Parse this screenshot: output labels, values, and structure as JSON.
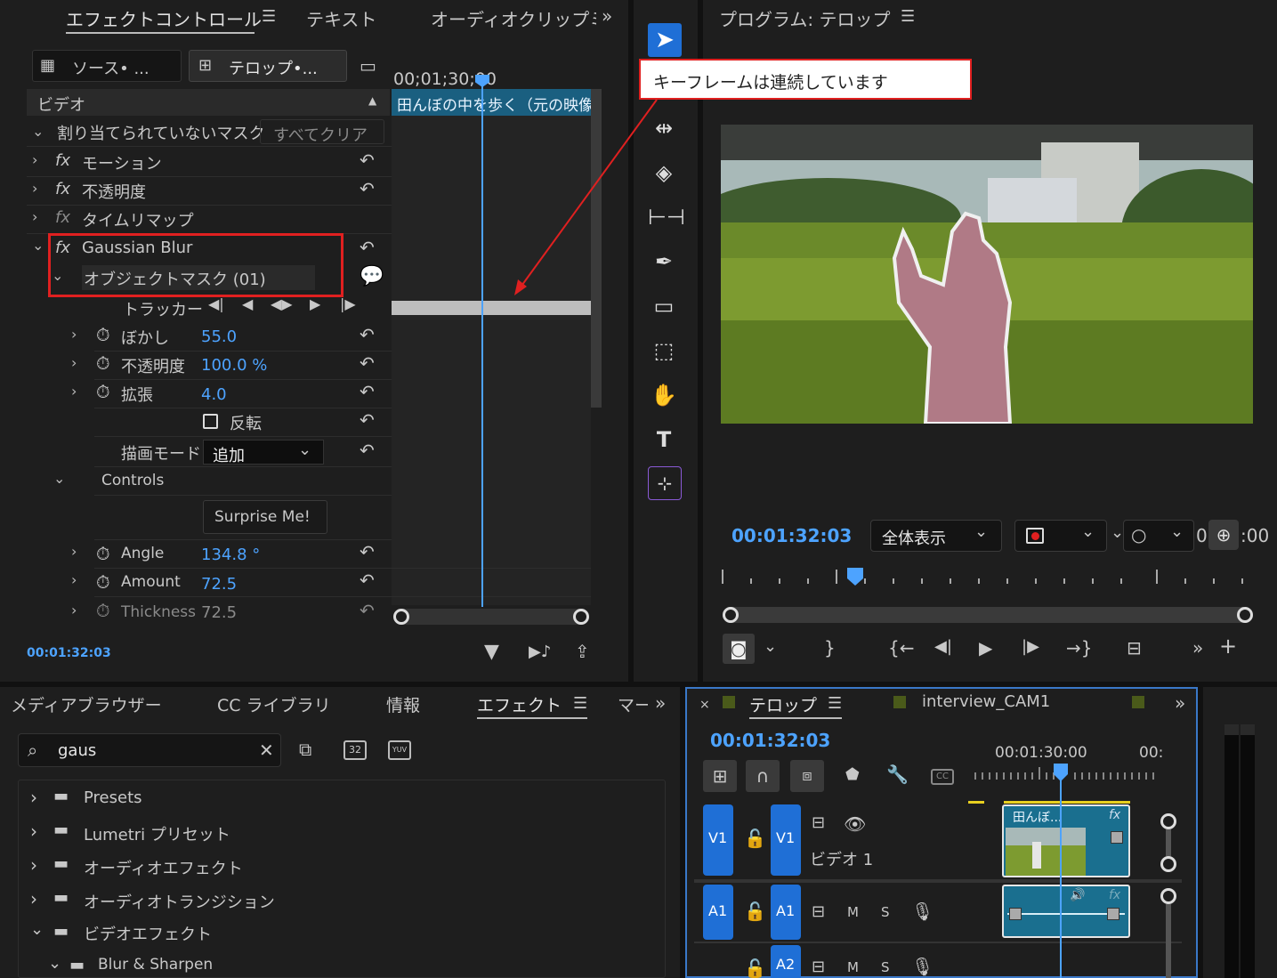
{
  "effect_controls": {
    "tabs": [
      "エフェクトコントロール",
      "テキスト",
      "オーディオクリップミ"
    ],
    "source_label": "ソース• ...",
    "sequence_label": "テロップ•...",
    "section_video": "ビデオ",
    "ruler_time": "00;01;30;00",
    "clip_name": "田んぼの中を歩く（元の映像",
    "unassigned_mask": "割り当てられていないマスク",
    "clear_all": "すべてクリア",
    "motion": "モーション",
    "opacity": "不透明度",
    "time_remap": "タイムリマップ",
    "gaussian_blur": "Gaussian Blur",
    "object_mask": "オブジェクトマスク (01)",
    "tracker": "トラッカー",
    "blur_label": "ぼかし",
    "blur_value": "55.0",
    "mask_opacity_label": "不透明度",
    "mask_opacity_value": "100.0 %",
    "expansion_label": "拡張",
    "expansion_value": "4.0",
    "invert_label": "反転",
    "blend_mode_label": "描画モード",
    "blend_mode_value": "追加",
    "controls_label": "Controls",
    "surprise_button": "Surprise Me!",
    "angle_label": "Angle",
    "angle_value": "134.8 °",
    "amount_label": "Amount",
    "amount_value": "72.5",
    "thickness_label": "Thickness",
    "thickness_value": "72.5",
    "timecode": "00:01:32:03"
  },
  "callout": {
    "text": "キーフレームは連続しています",
    "border_color": "#e02020"
  },
  "program": {
    "title": "プログラム: テロップ",
    "timecode": "00:01:32:03",
    "zoom": "全体表示",
    "duration_partial": "0",
    "duration_tail": ":00"
  },
  "bottom_left": {
    "tabs": [
      "メディアブラウザー",
      "CC ライブラリ",
      "情報",
      "エフェクト",
      "マー"
    ],
    "search_value": "gaus",
    "tree": [
      {
        "label": "Presets",
        "expanded": false,
        "level": 0
      },
      {
        "label": "Lumetri プリセット",
        "expanded": false,
        "level": 0
      },
      {
        "label": "オーディオエフェクト",
        "expanded": false,
        "level": 0
      },
      {
        "label": "オーディオトランジション",
        "expanded": false,
        "level": 0
      },
      {
        "label": "ビデオエフェクト",
        "expanded": true,
        "level": 0
      },
      {
        "label": "Blur & Sharpen",
        "expanded": true,
        "level": 1
      }
    ]
  },
  "timeline": {
    "tab1": "テロップ",
    "tab2": "interview_CAM1",
    "timecode": "00:01:32:03",
    "ruler_time": "00:01:30:00",
    "ruler_time2": "00:",
    "v1": "V1",
    "v1_name": "ビデオ 1",
    "a1": "A1",
    "a2": "A2",
    "m": "M",
    "s": "S",
    "clip_label": "田んぼ...",
    "fx_label": "fx"
  },
  "colors": {
    "accent_blue": "#4da3ff",
    "track_blue": "#1f6fd6",
    "clip_teal": "#1a6f8f",
    "highlight_red": "#e02020"
  }
}
